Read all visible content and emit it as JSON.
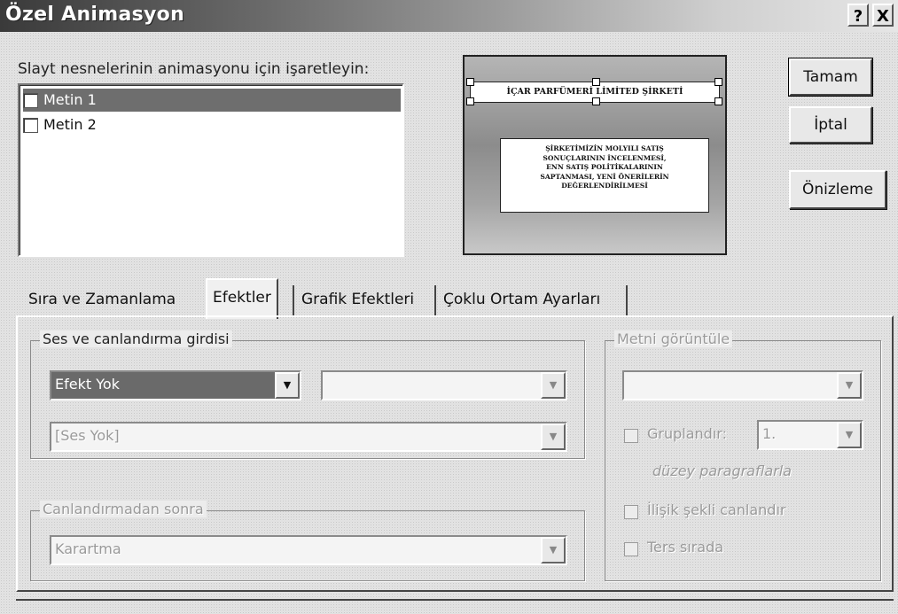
{
  "window": {
    "title": "Özel Animasyon",
    "help_btn": "?",
    "close_btn": "X"
  },
  "objects": {
    "label": "Slayt nesnelerinin animasyonu için işaretleyin:",
    "items": [
      {
        "label": "Metin 1",
        "checked": false,
        "selected": true
      },
      {
        "label": "Metin 2",
        "checked": false,
        "selected": false
      }
    ]
  },
  "preview": {
    "title_text": "İÇAR PARFÜMERİ LİMİTED ŞİRKETİ",
    "body_lines": [
      "ŞİRKETİMİZİN MOLYILI SATIŞ",
      "SONUÇLARININ İNCELENMESİ,",
      "ENN SATIŞ POLİTİKALARININ",
      "SAPTANMASI, YENİ ÖNERİLERİN",
      "DEĞERLENDİRİLMESİ"
    ]
  },
  "buttons": {
    "ok": "Tamam",
    "cancel": "İptal",
    "preview": "Önizleme"
  },
  "tabs": [
    {
      "label": "Sıra ve Zamanlama",
      "active": false
    },
    {
      "label": "Efektler",
      "active": true
    },
    {
      "label": "Grafik Efektleri",
      "active": false
    },
    {
      "label": "Çoklu Ortam Ayarları",
      "active": false
    }
  ],
  "effects": {
    "entry_group_title": "Ses ve canlandırma girdisi",
    "effect_value": "Efekt Yok",
    "effect_detail_value": "",
    "sound_value": "[Ses Yok]",
    "after_group_title": "Canlandırmadan sonra",
    "after_value": "Karartma",
    "text_group_title": "Metni görüntüle",
    "text_value": "",
    "group_by_label": "Gruplandır:",
    "group_level_value": "1.",
    "group_level_suffix": "düzey paragraflarla",
    "attached_shape_label": "İlişik şekli canlandır",
    "reverse_order_label": "Ters sırada"
  }
}
